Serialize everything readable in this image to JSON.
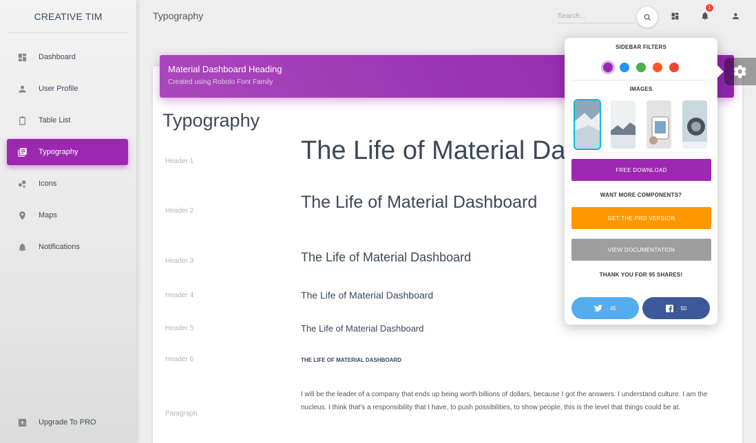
{
  "brand": "CREATIVE TIM",
  "sidebar": {
    "items": [
      {
        "label": "Dashboard",
        "icon": "dashboard-icon"
      },
      {
        "label": "User Profile",
        "icon": "person-icon"
      },
      {
        "label": "Table List",
        "icon": "clipboard-icon"
      },
      {
        "label": "Typography",
        "icon": "library-books-icon"
      },
      {
        "label": "Icons",
        "icon": "bubble-chart-icon"
      },
      {
        "label": "Maps",
        "icon": "location-pin-icon"
      },
      {
        "label": "Notifications",
        "icon": "bell-icon"
      }
    ],
    "active_index": 3,
    "bottom": {
      "label": "Upgrade To PRO",
      "icon": "unarchive-icon"
    }
  },
  "topbar": {
    "title": "Typography",
    "search_placeholder": "Search...",
    "notification_count": "1"
  },
  "card_header": {
    "title": "Material Dashboard Heading",
    "subtitle": "Created using Roboto Font Family"
  },
  "typography": {
    "title": "Typography",
    "rows": [
      {
        "label": "Header 1",
        "text": "The Life of Material Dashboard"
      },
      {
        "label": "Header 2",
        "text": "The Life of Material Dashboard"
      },
      {
        "label": "Header 3",
        "text": "The Life of Material Dashboard"
      },
      {
        "label": "Header 4",
        "text": "The Life of Material Dashboard"
      },
      {
        "label": "Header 5",
        "text": "The Life of Material Dashboard"
      },
      {
        "label": "Header 6",
        "text": "THE LIFE OF MATERIAL DASHBOARD"
      },
      {
        "label": "Paragraph",
        "text": "I will be the leader of a company that ends up being worth billions of dollars, because I got the answers. I understand culture. I am the nucleus. I think that’s a responsibility that I have, to push possibilities, to show people, this is the level that things could be at."
      }
    ]
  },
  "plugin": {
    "sidebar_filters_title": "SIDEBAR FILTERS",
    "filter_colors": [
      "#9c27b0",
      "#2196f3",
      "#4caf50",
      "#ff5722",
      "#f44336"
    ],
    "selected_filter": 0,
    "images_title": "IMAGES",
    "selected_image": 0,
    "free_download": "FREE DOWNLOAD",
    "want_more": "WANT MORE COMPONENTS?",
    "get_pro": "GET THE PRO VERSION",
    "view_docs": "VIEW DOCUMENTATION",
    "thanks": "THANK YOU FOR 95 SHARES!",
    "twitter_count": "· 45",
    "facebook_count": "· 50"
  },
  "colors": {
    "primary": "#9c27b0",
    "warning": "#ff9800",
    "twitter": "#55acee",
    "facebook": "#3b5998"
  }
}
